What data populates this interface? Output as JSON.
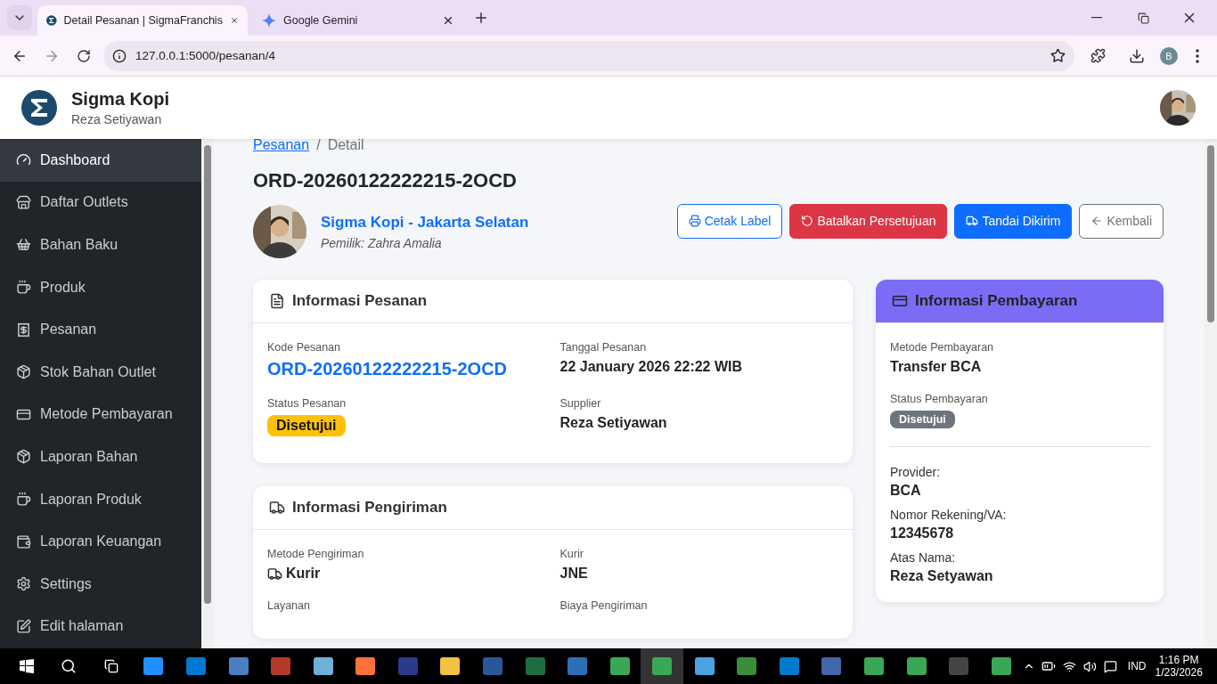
{
  "browser": {
    "tabs": [
      {
        "title": "Detail Pesanan | SigmaFranchis",
        "selected": true
      },
      {
        "title": "Google Gemini",
        "selected": false
      }
    ],
    "address": "127.0.0.1:5000/pesanan/4",
    "profile": "B"
  },
  "header": {
    "brand": "Sigma Kopi",
    "user": "Reza Setiyawan"
  },
  "sidebar": {
    "items": [
      {
        "label": "Dashboard",
        "selected": true
      },
      {
        "label": "Daftar Outlets",
        "selected": false
      },
      {
        "label": "Bahan Baku",
        "selected": false
      },
      {
        "label": "Produk",
        "selected": false
      },
      {
        "label": "Pesanan",
        "selected": false
      },
      {
        "label": "Stok Bahan Outlet",
        "selected": false
      },
      {
        "label": "Metode Pembayaran",
        "selected": false
      },
      {
        "label": "Laporan Bahan",
        "selected": false
      },
      {
        "label": "Laporan Produk",
        "selected": false
      },
      {
        "label": "Laporan Keuangan",
        "selected": false
      },
      {
        "label": "Settings",
        "selected": false
      },
      {
        "label": "Edit halaman",
        "selected": false
      }
    ]
  },
  "breadcrumb": {
    "link": "Pesanan",
    "separator": "/",
    "current": "Detail"
  },
  "order_title": "ORD-20260122222215-2OCD",
  "outlet": {
    "name": "Sigma Kopi - Jakarta Selatan",
    "owner": "Pemilik: Zahra Amalia"
  },
  "actions": [
    {
      "label": "Cetak Label",
      "kind": "outline-primary"
    },
    {
      "label": "Batalkan Persetujuan",
      "kind": "danger"
    },
    {
      "label": "Tandai Dikirim",
      "kind": "primary"
    },
    {
      "label": "Kembali",
      "kind": "outline-secondary"
    }
  ],
  "order_info": {
    "title": "Informasi Pesanan",
    "fields": [
      {
        "label": "Kode Pesanan",
        "value": "ORD-20260122222215-2OCD",
        "kind": "link"
      },
      {
        "label": "Tanggal Pesanan",
        "value": "22 January 2026 22:22 WIB",
        "kind": "text"
      },
      {
        "label": "Status Pesanan",
        "value": "Disetujui",
        "kind": "badge",
        "color": "#ffc107"
      },
      {
        "label": "Supplier",
        "value": "Reza Setiyawan",
        "kind": "text"
      }
    ]
  },
  "shipping_info": {
    "title": "Informasi Pengiriman",
    "fields": [
      {
        "label": "Metode Pengiriman",
        "value": "Kurir",
        "kind": "truck"
      },
      {
        "label": "Kurir",
        "value": "JNE",
        "kind": "text"
      },
      {
        "label": "Layanan",
        "kind": "text"
      },
      {
        "label": "Biaya Pengiriman",
        "kind": "text"
      }
    ]
  },
  "payment_info": {
    "title": "Informasi Pembayaran",
    "fields": [
      {
        "label": "Metode Pembayaran",
        "value": "Transfer BCA",
        "kind": "text"
      },
      {
        "label": "Status Pembayaran",
        "value": "Disetujui",
        "kind": "badge",
        "color": "#6c757d"
      },
      {
        "kind": "divider"
      },
      {
        "label": "Provider:",
        "value": "BCA",
        "kind": "plain"
      },
      {
        "label": "Nomor Rekening/VA:",
        "value": "12345678",
        "kind": "plain"
      },
      {
        "label": "Atas Nama:",
        "value": "Reza Setyawan",
        "kind": "plain"
      }
    ]
  },
  "taskbar": {
    "language": "IND",
    "time": "1:16 PM",
    "date": "1/23/2026"
  }
}
